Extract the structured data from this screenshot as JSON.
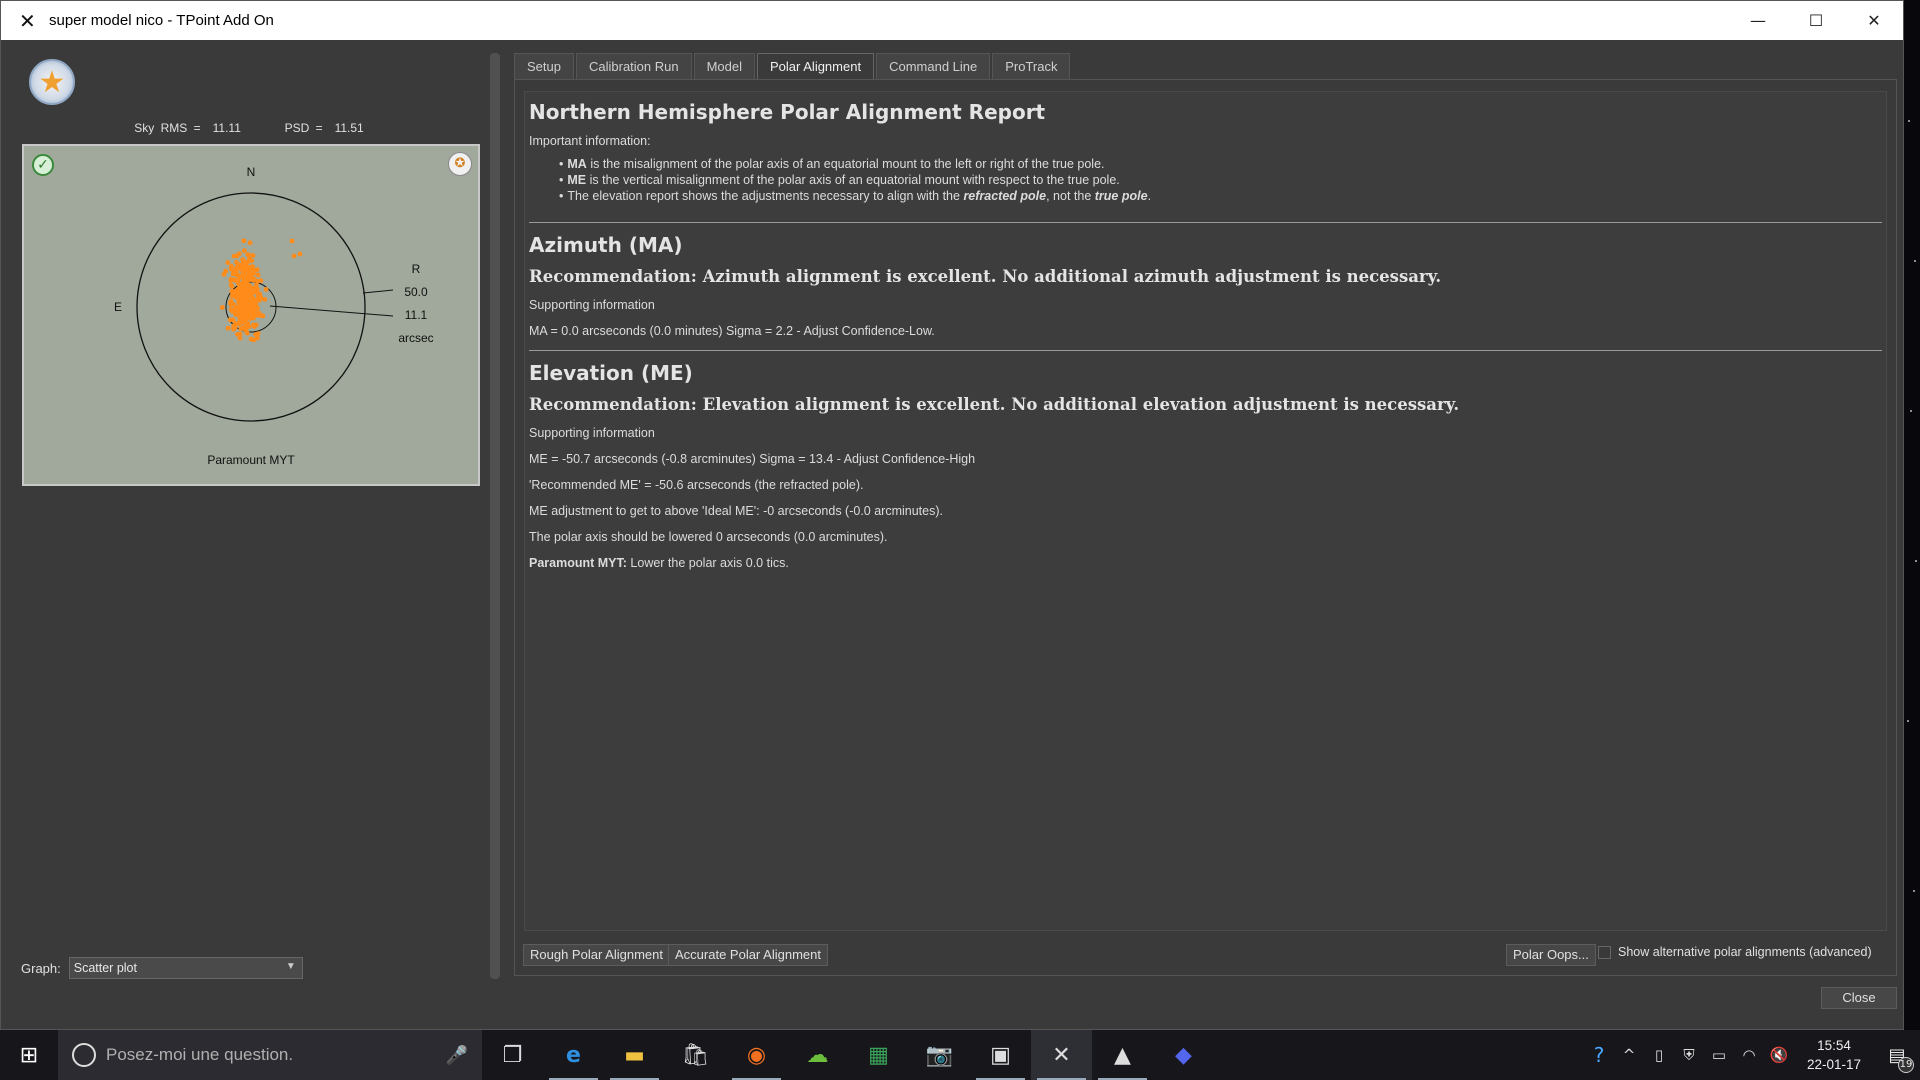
{
  "window": {
    "title": "super model nico - TPoint Add On"
  },
  "left": {
    "sky_rms_label": "Sky RMS =",
    "sky_rms_value": "11.11",
    "psd_label": "PSD =",
    "psd_value": "11.51",
    "plot": {
      "north_label": "N",
      "east_label": "E",
      "r_label": "R",
      "outer_value": "50.0",
      "inner_value": "11.1",
      "unit_label": "arcsec",
      "mount_label": "Paramount MYT"
    },
    "graph_label": "Graph:",
    "graph_value": "Scatter plot"
  },
  "tabs": [
    "Setup",
    "Calibration Run",
    "Model",
    "Polar Alignment",
    "Command Line",
    "ProTrack"
  ],
  "report": {
    "title": "Northern Hemisphere Polar Alignment Report",
    "important": "Important information:",
    "bullet1_b": "MA",
    "bullet1_text": " is the misalignment of the polar axis of an equatorial mount to the left or right of the true pole.",
    "bullet2_b": "ME",
    "bullet2_text": " is the vertical misalignment of the polar axis of an equatorial mount with respect to the true pole.",
    "bullet3_a": "The elevation report shows the adjustments necessary to align with the ",
    "bullet3_b1": "refracted pole",
    "bullet3_c": ", not the ",
    "bullet3_b2": "true pole",
    "bullet3_d": ".",
    "az_title": "Azimuth (MA)",
    "az_rec": "Recommendation: Azimuth alignment is excellent. No additional azimuth adjustment is necessary.",
    "az_support": "Supporting information",
    "az_ma": "MA = 0.0 arcseconds (0.0 minutes) Sigma = 2.2 - Adjust Confidence-Low.",
    "el_title": "Elevation (ME)",
    "el_rec": "Recommendation: Elevation alignment is excellent. No additional elevation adjustment is necessary.",
    "el_support": "Supporting information",
    "el_me": "ME = -50.7 arcseconds (-0.8 arcminutes) Sigma = 13.4 - Adjust Confidence-High",
    "el_rec_me": "'Recommended ME' = -50.6 arcseconds (the refracted pole).",
    "el_adjust": "ME adjustment to get to above 'Ideal ME': -0 arcseconds (-0.0 arcminutes).",
    "el_lower": "The polar axis should be lowered 0 arcseconds (0.0 arcminutes).",
    "el_mount_b": "Paramount MYT:",
    "el_mount_text": " Lower the polar axis 0.0 tics."
  },
  "buttons": {
    "rough": "Rough Polar Alignment",
    "accurate": "Accurate Polar Alignment",
    "oops": "Polar Oops...",
    "alt_label": "Show alternative polar alignments (advanced)",
    "close": "Close"
  },
  "taskbar": {
    "search_placeholder": "Posez-moi une question.",
    "time": "15:54",
    "date": "22-01-17",
    "notifications": "19"
  }
}
